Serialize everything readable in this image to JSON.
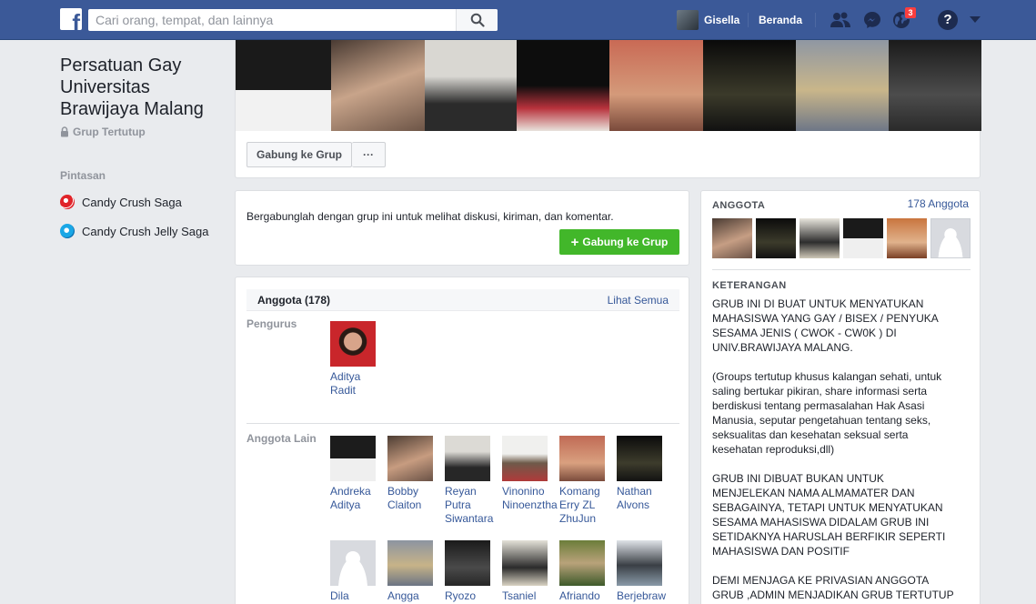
{
  "topbar": {
    "search_placeholder": "Cari orang, tempat, dan lainnya",
    "user_name": "Gisella",
    "home_label": "Beranda",
    "notification_count": "3",
    "help_label": "?"
  },
  "group": {
    "title": "Persatuan Gay Universitas Brawijaya Malang",
    "privacy": "Grup Tertutup"
  },
  "shortcuts": {
    "heading": "Pintasan",
    "items": [
      {
        "label": "Candy Crush Saga",
        "icon": "candy-crush-icon"
      },
      {
        "label": "Candy Crush Jelly Saga",
        "icon": "candy-crush-jelly-icon"
      }
    ]
  },
  "cover_actions": {
    "join_label": "Gabung ke Grup",
    "more_label": "···"
  },
  "join_prompt": {
    "text": "Bergabunglah dengan grup ini untuk melihat diskusi, kiriman, dan komentar.",
    "button_label": "Gabung ke Grup"
  },
  "members_panel": {
    "title": "Anggota (178)",
    "see_all": "Lihat Semua",
    "admins_label": "Pengurus",
    "admins": [
      {
        "name": "Aditya Radit"
      }
    ],
    "others_label": "Anggota Lain",
    "others_row1": [
      {
        "name": "Andreka Aditya"
      },
      {
        "name": "Bobby Claiton"
      },
      {
        "name": "Reyan Putra Siwantara"
      },
      {
        "name": "Vinonino Ninoenztha"
      },
      {
        "name": "Komang Erry ZL ZhuJun"
      },
      {
        "name": "Nathan Alvons"
      }
    ],
    "others_row2": [
      {
        "name": "Dila"
      },
      {
        "name": "Angga"
      },
      {
        "name": "Ryozo"
      },
      {
        "name": "Tsaniel"
      },
      {
        "name": "Afriando"
      },
      {
        "name": "Berjebraw"
      }
    ]
  },
  "sidebar": {
    "members_heading": "ANGGOTA",
    "members_count": "178 Anggota",
    "description_heading": "KETERANGAN",
    "description": "GRUB INI DI BUAT UNTUK MENYATUKAN MAHASISWA YANG GAY / BISEX / PENYUKA SESAMA JENIS ( CWOK - CW0K ) DI UNIV.BRAWIJAYA MALANG.\n\n(Groups tertutup khusus kalangan sehati, untuk saling bertukar pikiran, share informasi serta berdiskusi tentang permasalahan Hak Asasi Manusia, seputar pengetahuan tentang seks, seksualitas dan kesehatan seksual serta kesehatan reproduksi,dll)\n\nGRUB INI DIBUAT BUKAN UNTUK MENJELEKAN NAMA ALMAMATER DAN SEBAGAINYA, TETAPI UNTUK MENYATUKAN SESAMA MAHASISWA DIDALAM GRUB INI SETIDAKNYA HARUSLAH BERFIKIR SEPERTI MAHASISWA DAN POSITIF\n\nDEMI MENJAGA KE PRIVASIAN ANGGOTA GRUB ,ADMIN MENJADIKAN GRUB TERTUTUP AGAR DAPAT MENJAGA KE PRIVASIAN ANGGOTA"
  },
  "colors": {
    "brand_blue": "#3b5998",
    "link_blue": "#365899",
    "join_green": "#42b72a",
    "page_bg": "#e9ebee",
    "badge_red": "#fa3e3e"
  }
}
